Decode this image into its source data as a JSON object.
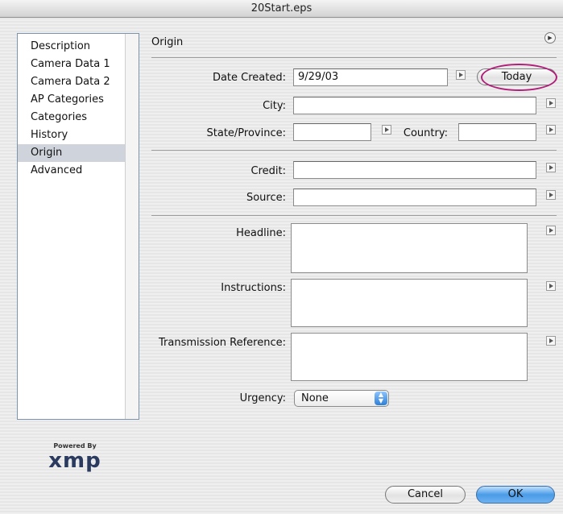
{
  "window": {
    "title": "20Start.eps"
  },
  "sidebar": {
    "items": [
      {
        "label": "Description"
      },
      {
        "label": "Camera Data 1"
      },
      {
        "label": "Camera Data 2"
      },
      {
        "label": "AP Categories"
      },
      {
        "label": "Categories"
      },
      {
        "label": "History"
      },
      {
        "label": "Origin",
        "selected": true
      },
      {
        "label": "Advanced"
      }
    ]
  },
  "section": {
    "title": "Origin"
  },
  "form": {
    "date_created": {
      "label": "Date Created:",
      "value": "9/29/03"
    },
    "today_button": "Today",
    "city": {
      "label": "City:",
      "value": ""
    },
    "state": {
      "label": "State/Province:",
      "value": ""
    },
    "country": {
      "label": "Country:",
      "value": ""
    },
    "credit": {
      "label": "Credit:",
      "value": ""
    },
    "source": {
      "label": "Source:",
      "value": ""
    },
    "headline": {
      "label": "Headline:",
      "value": ""
    },
    "instructions": {
      "label": "Instructions:",
      "value": ""
    },
    "transmission": {
      "label": "Transmission Reference:",
      "value": ""
    },
    "urgency": {
      "label": "Urgency:",
      "value": "None"
    }
  },
  "logo": {
    "powered_by": "Powered By",
    "name": "xmp"
  },
  "buttons": {
    "cancel": "Cancel",
    "ok": "OK"
  },
  "colors": {
    "highlight_ring": "#b0207a",
    "ok_button": "#4a9be6",
    "selected_item": "#cfd4dc"
  }
}
